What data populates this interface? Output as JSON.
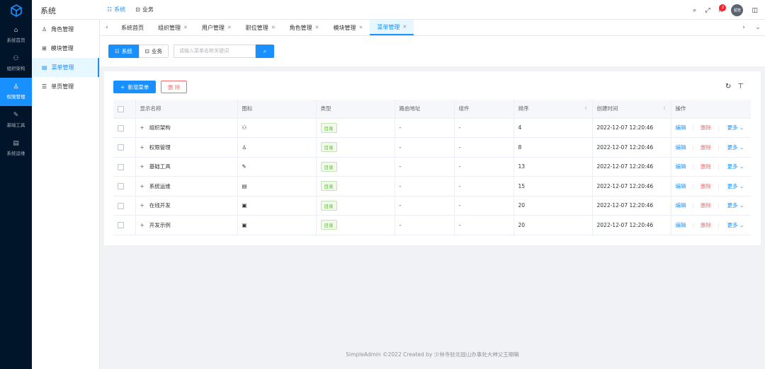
{
  "rail": {
    "items": [
      {
        "label": "系统首页",
        "icon": "home-icon",
        "glyph": "⌂",
        "active": false
      },
      {
        "label": "组织架构",
        "icon": "org-icon",
        "glyph": "⚇",
        "active": false
      },
      {
        "label": "权限管理",
        "icon": "user-icon",
        "glyph": "♙",
        "active": true
      },
      {
        "label": "基础工具",
        "icon": "tool-icon",
        "glyph": "✎",
        "active": false
      },
      {
        "label": "系统运维",
        "icon": "server-icon",
        "glyph": "▤",
        "active": false
      }
    ]
  },
  "header": {
    "title": "系统",
    "nav": [
      {
        "label": "系统",
        "glyph": "☷",
        "active": true
      },
      {
        "label": "业务",
        "glyph": "⊡",
        "active": false
      }
    ],
    "notification_count": "2",
    "avatar_text": "超管"
  },
  "sidebar": {
    "items": [
      {
        "label": "角色管理",
        "glyph": "♙",
        "active": false
      },
      {
        "label": "模块管理",
        "glyph": "⊞",
        "active": false
      },
      {
        "label": "菜单管理",
        "glyph": "▤",
        "active": true
      },
      {
        "label": "单页管理",
        "glyph": "☰",
        "active": false
      }
    ]
  },
  "tabs": {
    "items": [
      {
        "label": "系统首页",
        "closable": false,
        "active": false
      },
      {
        "label": "组织管理",
        "closable": true,
        "active": false
      },
      {
        "label": "用户管理",
        "closable": true,
        "active": false
      },
      {
        "label": "职位管理",
        "closable": true,
        "active": false
      },
      {
        "label": "角色管理",
        "closable": true,
        "active": false
      },
      {
        "label": "模块管理",
        "closable": true,
        "active": false
      },
      {
        "label": "菜单管理",
        "closable": true,
        "active": true
      }
    ]
  },
  "filter": {
    "seg_system": "系统",
    "seg_business": "业务",
    "search_placeholder": "请输入菜单名称关键词"
  },
  "actions": {
    "add_label": "新增菜单",
    "delete_label": "删 除"
  },
  "table": {
    "columns": [
      "显示名称",
      "图标",
      "类型",
      "路由地址",
      "组件",
      "排序",
      "创建时间",
      "操作"
    ],
    "op_edit": "编辑",
    "op_delete": "删除",
    "op_more": "更多",
    "rows": [
      {
        "name": "组织架构",
        "icon": "org-icon",
        "glyph": "⚇",
        "type": "目录",
        "route": "-",
        "component": "-",
        "sort": "4",
        "created": "2022-12-07 12:20:46"
      },
      {
        "name": "权限管理",
        "icon": "user-icon",
        "glyph": "♙",
        "type": "目录",
        "route": "-",
        "component": "-",
        "sort": "8",
        "created": "2022-12-07 12:20:46"
      },
      {
        "name": "基础工具",
        "icon": "tool-icon",
        "glyph": "✎",
        "type": "目录",
        "route": "-",
        "component": "-",
        "sort": "13",
        "created": "2022-12-07 12:20:46"
      },
      {
        "name": "系统运维",
        "icon": "server-icon",
        "glyph": "▤",
        "type": "目录",
        "route": "-",
        "component": "-",
        "sort": "15",
        "created": "2022-12-07 12:20:46"
      },
      {
        "name": "在线开发",
        "icon": "window-icon",
        "glyph": "▣",
        "type": "目录",
        "route": "-",
        "component": "-",
        "sort": "20",
        "created": "2022-12-07 12:20:46"
      },
      {
        "name": "开发示例",
        "icon": "window-icon",
        "glyph": "▣",
        "type": "目录",
        "route": "-",
        "component": "-",
        "sort": "20",
        "created": "2022-12-07 12:20:46"
      }
    ]
  },
  "footer": "SimpleAdmin ©2022 Created by 少林寺驻北固山办事处大神父王喇嘛",
  "colors": {
    "primary": "#1890ff",
    "danger": "#f56c6c",
    "success": "#67c23a",
    "rail_bg": "#001529"
  }
}
